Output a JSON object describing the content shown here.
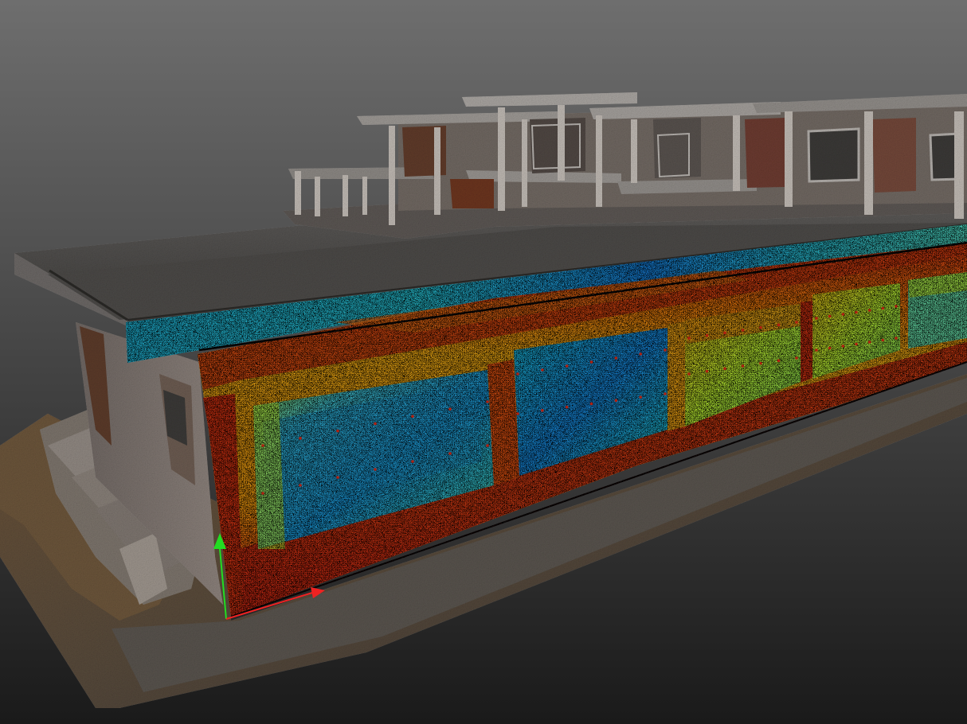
{
  "scene": {
    "subject": "point-cloud-building-scan",
    "background_colors": [
      "#6e6e6e",
      "#1a1a1a"
    ],
    "deviation_palette": [
      "#1e90ff",
      "#22c8e6",
      "#c8ff3a",
      "#ffd21a",
      "#ff8a12",
      "#e8401a",
      "#c01a10"
    ],
    "scan_gray": "#8a8580",
    "scan_dark": "#4a4440",
    "ground_brown": "#5a4a38",
    "axis": {
      "y_color": "#22dd22",
      "x_color": "#ee2222",
      "y_icon": "axis-arrow-up-icon",
      "x_icon": "axis-arrow-right-icon"
    }
  }
}
